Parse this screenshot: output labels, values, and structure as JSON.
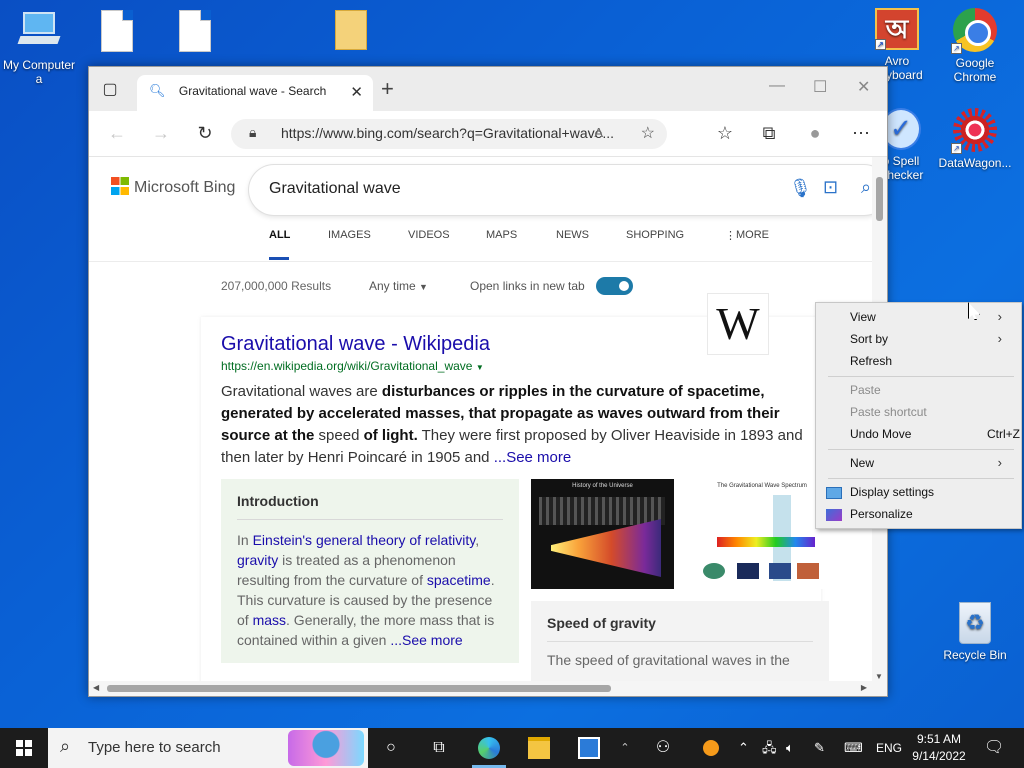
{
  "desktop": {
    "icons": [
      {
        "label": "My Computer a"
      },
      {
        "label": ""
      },
      {
        "label": ""
      },
      {
        "label": ""
      },
      {
        "label": "Avro Keyboard"
      },
      {
        "label": "Google Chrome"
      },
      {
        "label": "o Spell Checker"
      },
      {
        "label": "DataWagon..."
      },
      {
        "label": "Recycle Bin"
      }
    ]
  },
  "browser": {
    "tab_title": "Gravitational wave - Search",
    "url": "https://www.bing.com/search?q=Gravitational+wave...",
    "bing_brand": "Microsoft Bing",
    "query": "Gravitational wave",
    "nav_tabs": [
      "ALL",
      "IMAGES",
      "VIDEOS",
      "MAPS",
      "NEWS",
      "SHOPPING",
      "MORE"
    ],
    "results_count": "207,000,000 Results",
    "time_filter": "Any time",
    "open_links_label": "Open links in new tab",
    "result": {
      "title": "Gravitational wave - Wikipedia",
      "url": "https://en.wikipedia.org/wiki/Gravitational_wave",
      "snippet_1": "Gravitational waves are ",
      "snippet_bold_1": "disturbances or ripples in the curvature of spacetime, generated by accelerated masses, that propagate as waves outward from their source at the",
      "snippet_2": " speed ",
      "snippet_bold_2": "of light.",
      "snippet_3": " They were first proposed by Oliver Heaviside in 1893 and then later by Henri Poincaré in 1905 and ",
      "see_more": "...See more",
      "wiki_logo": "W",
      "intro_heading": "Introduction",
      "intro_1": "In ",
      "intro_link_1": "Einstein's general theory of relativity",
      "intro_2": ", ",
      "intro_link_2": "gravity",
      "intro_3": " is treated as a phenomenon resulting from the curvature of ",
      "intro_link_3": "spacetime",
      "intro_4": ". This curvature is caused by the presence of ",
      "intro_link_4": "mass",
      "intro_5": ". Generally, the more mass that is contained within a given ",
      "intro_see_more": "...See more",
      "image1_caption": "History of the Universe",
      "image2_caption": "The Gravitational Wave Spectrum",
      "speed_heading": "Speed of gravity",
      "speed_text": "The speed of gravitational waves in the"
    }
  },
  "context_menu": {
    "view": "View",
    "sort_by": "Sort by",
    "refresh": "Refresh",
    "paste": "Paste",
    "paste_shortcut": "Paste shortcut",
    "undo_move": "Undo Move",
    "undo_shortcut": "Ctrl+Z",
    "new": "New",
    "display_settings": "Display settings",
    "personalize": "Personalize"
  },
  "taskbar": {
    "search_placeholder": "Type here to search",
    "language": "ENG",
    "time": "9:51 AM",
    "date": "9/14/2022"
  },
  "colors": {
    "desktop_bg": "#0a62d6",
    "bing_link": "#1a0dab",
    "toggle_on": "#1d7aa8",
    "taskbar": "#1c1c1c"
  }
}
